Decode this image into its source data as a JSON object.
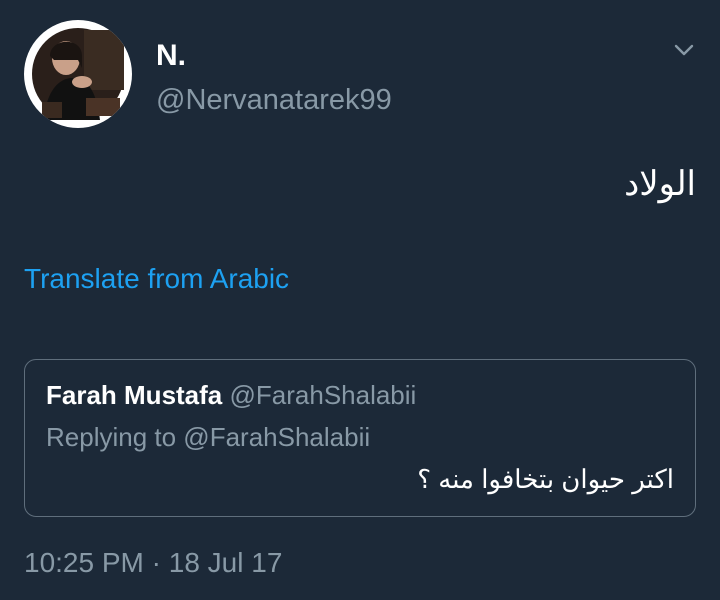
{
  "tweet": {
    "author": {
      "display_name": "N.",
      "handle": "@Nervanatarek99"
    },
    "text": "الولاد",
    "translate_link": "Translate from Arabic",
    "timestamp": {
      "time": "10:25 PM",
      "separator": " · ",
      "date": "18 Jul 17"
    }
  },
  "quoted_tweet": {
    "author": {
      "display_name": "Farah Mustafa",
      "handle": "@FarahShalabii"
    },
    "replying_to": "Replying to @FarahShalabii",
    "text": "اكتر حيوان بتخافوا منه ؟"
  },
  "icons": {
    "menu": "chevron-down-icon"
  },
  "colors": {
    "background": "#1c2938",
    "primary_text": "#ffffff",
    "secondary_text": "#8899a6",
    "link": "#1da1f2",
    "quote_border": "#5f6e7c"
  }
}
